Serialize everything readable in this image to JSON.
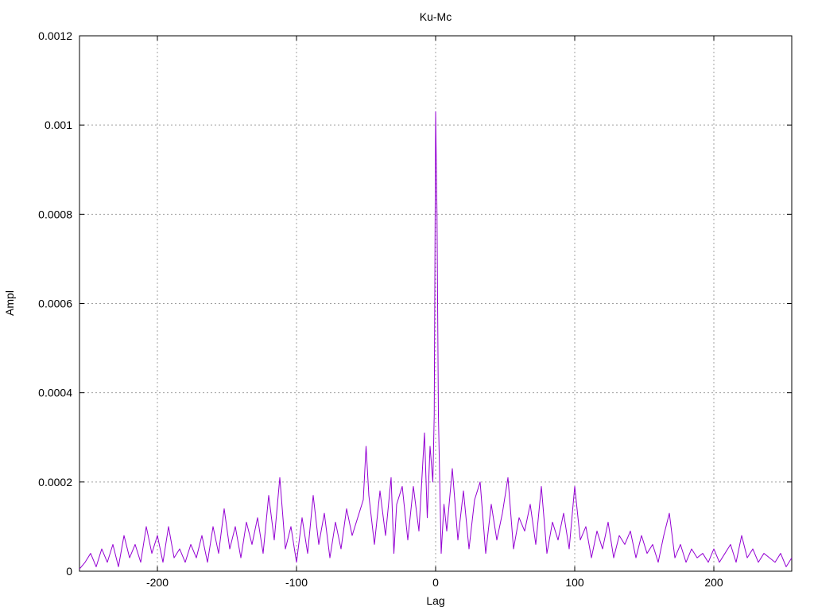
{
  "chart_data": {
    "type": "line",
    "title": "Ku-Mc",
    "xlabel": "Lag",
    "ylabel": "Ampl",
    "xlim": [
      -256,
      256
    ],
    "ylim": [
      0,
      0.0012
    ],
    "grid": true,
    "legend": "none",
    "x_ticks": [
      {
        "value": -200,
        "label": "-200"
      },
      {
        "value": -100,
        "label": "-100"
      },
      {
        "value": 0,
        "label": "0"
      },
      {
        "value": 100,
        "label": "100"
      },
      {
        "value": 200,
        "label": "200"
      }
    ],
    "y_ticks": [
      {
        "value": 0,
        "label": "0"
      },
      {
        "value": 0.0002,
        "label": "0.0002"
      },
      {
        "value": 0.0004,
        "label": "0.0004"
      },
      {
        "value": 0.0006,
        "label": "0.0006"
      },
      {
        "value": 0.0008,
        "label": "0.0008"
      },
      {
        "value": 0.001,
        "label": "0.001"
      },
      {
        "value": 0.0012,
        "label": "0.0012"
      }
    ],
    "series": [
      {
        "color": "#9400d3",
        "x": [
          -256,
          -252,
          -248,
          -244,
          -240,
          -236,
          -232,
          -228,
          -224,
          -220,
          -216,
          -212,
          -208,
          -204,
          -200,
          -196,
          -192,
          -188,
          -184,
          -180,
          -176,
          -172,
          -168,
          -164,
          -160,
          -156,
          -152,
          -148,
          -144,
          -140,
          -136,
          -132,
          -128,
          -124,
          -120,
          -116,
          -112,
          -108,
          -104,
          -100,
          -96,
          -92,
          -88,
          -84,
          -80,
          -76,
          -72,
          -68,
          -64,
          -60,
          -56,
          -52,
          -50,
          -48,
          -44,
          -40,
          -36,
          -32,
          -30,
          -28,
          -24,
          -20,
          -16,
          -12,
          -8,
          -6,
          -4,
          -2,
          -1,
          0,
          1,
          2,
          4,
          6,
          8,
          12,
          16,
          20,
          24,
          28,
          32,
          36,
          40,
          44,
          48,
          52,
          56,
          60,
          64,
          68,
          72,
          76,
          80,
          84,
          88,
          92,
          96,
          100,
          104,
          108,
          112,
          116,
          120,
          124,
          128,
          132,
          136,
          140,
          144,
          148,
          152,
          156,
          160,
          164,
          168,
          172,
          176,
          180,
          184,
          188,
          192,
          196,
          200,
          204,
          208,
          212,
          216,
          220,
          224,
          228,
          232,
          236,
          240,
          244,
          248,
          252,
          256
        ],
        "y": [
          5e-06,
          2e-05,
          4e-05,
          1e-05,
          5e-05,
          2e-05,
          6e-05,
          1e-05,
          8e-05,
          3e-05,
          6e-05,
          2e-05,
          0.0001,
          4e-05,
          8e-05,
          2e-05,
          0.0001,
          3e-05,
          5e-05,
          2e-05,
          6e-05,
          3e-05,
          8e-05,
          2e-05,
          0.0001,
          4e-05,
          0.00014,
          5e-05,
          0.0001,
          3e-05,
          0.00011,
          6e-05,
          0.00012,
          4e-05,
          0.00017,
          7e-05,
          0.00021,
          5e-05,
          0.0001,
          2e-05,
          0.00012,
          4e-05,
          0.00017,
          6e-05,
          0.00013,
          3e-05,
          0.00011,
          5e-05,
          0.00014,
          8e-05,
          0.00012,
          0.00016,
          0.00028,
          0.00017,
          6e-05,
          0.00018,
          8e-05,
          0.00021,
          4e-05,
          0.00015,
          0.00019,
          7e-05,
          0.00019,
          9e-05,
          0.00031,
          0.00012,
          0.00028,
          0.0002,
          0.00035,
          0.00103,
          0.0008,
          0.00035,
          4e-05,
          0.00015,
          9e-05,
          0.00023,
          7e-05,
          0.00018,
          5e-05,
          0.00016,
          0.0002,
          4e-05,
          0.00015,
          7e-05,
          0.00013,
          0.00021,
          5e-05,
          0.00012,
          9e-05,
          0.00015,
          6e-05,
          0.00019,
          4e-05,
          0.00011,
          7e-05,
          0.00013,
          5e-05,
          0.00019,
          7e-05,
          0.0001,
          3e-05,
          9e-05,
          5e-05,
          0.00011,
          3e-05,
          8e-05,
          6e-05,
          9e-05,
          3e-05,
          8e-05,
          4e-05,
          6e-05,
          2e-05,
          8e-05,
          0.00013,
          3e-05,
          6e-05,
          2e-05,
          5e-05,
          3e-05,
          4e-05,
          2e-05,
          5e-05,
          2e-05,
          4e-05,
          6e-05,
          2e-05,
          8e-05,
          3e-05,
          5e-05,
          2e-05,
          4e-05,
          3e-05,
          2e-05,
          4e-05,
          1e-05,
          3e-05
        ]
      }
    ]
  }
}
